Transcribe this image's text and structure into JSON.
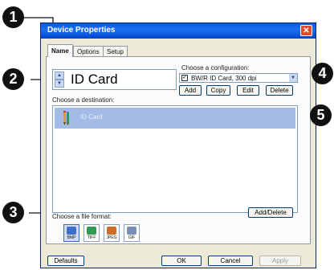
{
  "window": {
    "title": "Device Properties"
  },
  "tabs": [
    {
      "label": "Name"
    },
    {
      "label": "Options"
    },
    {
      "label": "Setup"
    }
  ],
  "device_name": {
    "value": "ID Card"
  },
  "configuration": {
    "label": "Choose a configuration:",
    "selected": "BW/R ID Card, 300 dpi",
    "checked": true,
    "buttons": {
      "add": "Add",
      "copy": "Copy",
      "edit": "Edit",
      "delete": "Delete"
    }
  },
  "destination": {
    "label": "Choose a destination:",
    "items": [
      {
        "label": "ID Card"
      }
    ],
    "add_delete": "Add/Delete"
  },
  "file_format": {
    "label": "Choose a file format:",
    "formats": [
      {
        "label": "BMP",
        "color": "#3b6fc9",
        "selected": true
      },
      {
        "label": "TIFF",
        "color": "#2f9a52",
        "selected": false
      },
      {
        "label": "JPEG",
        "color": "#d06a24",
        "selected": false
      },
      {
        "label": "GIF",
        "color": "#7a8db8",
        "selected": false
      }
    ]
  },
  "footer": {
    "defaults": "Defaults",
    "ok": "OK",
    "cancel": "Cancel",
    "apply": "Apply"
  },
  "callouts": [
    "1",
    "2",
    "3",
    "4",
    "5"
  ],
  "colors": {
    "title_bar": "#0a5ce0",
    "selection": "#a3bbe6",
    "dialog_bg": "#ece9d8"
  }
}
